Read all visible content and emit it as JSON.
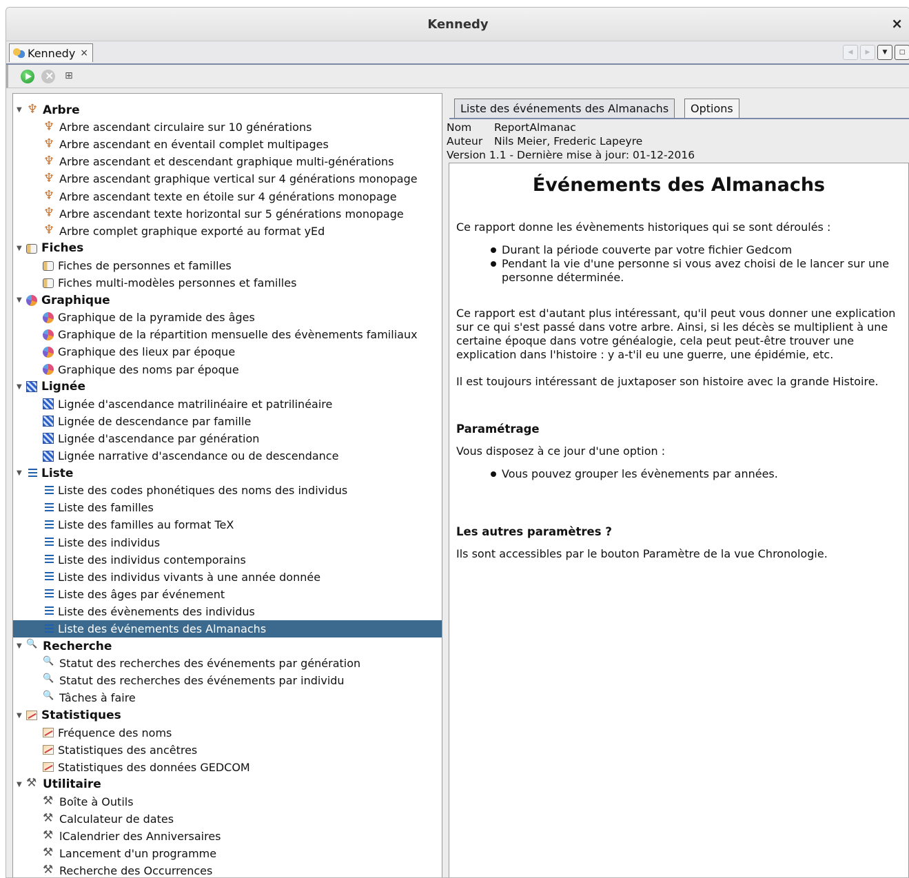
{
  "window": {
    "title": "Kennedy"
  },
  "doc_tab": {
    "label": "Kennedy"
  },
  "tree": [
    {
      "label": "Arbre",
      "icon": "arbre",
      "items": [
        "Arbre ascendant circulaire sur 10 générations",
        "Arbre ascendant en éventail complet multipages",
        "Arbre ascendant et descendant graphique multi-générations",
        "Arbre ascendant graphique vertical sur 4 générations monopage",
        "Arbre ascendant texte en étoile sur 4 générations monopage",
        "Arbre ascendant texte horizontal sur 5 générations monopage",
        "Arbre complet graphique exporté au format yEd"
      ]
    },
    {
      "label": "Fiches",
      "icon": "fiches",
      "items": [
        "Fiches de personnes et familles",
        "Fiches multi-modèles personnes et familles"
      ]
    },
    {
      "label": "Graphique",
      "icon": "graph",
      "items": [
        "Graphique de la pyramide des âges",
        "Graphique de la répartition mensuelle des évènements familiaux",
        "Graphique des lieux par époque",
        "Graphique des noms par époque"
      ]
    },
    {
      "label": "Lignée",
      "icon": "lignee",
      "items": [
        "Lignée d'ascendance matrilinéaire et patrilinéaire",
        "Lignée de descendance par famille",
        "Lignée d'ascendance par génération",
        "Lignée narrative d'ascendance ou de descendance"
      ]
    },
    {
      "label": "Liste",
      "icon": "liste",
      "items": [
        "Liste des codes phonétiques des noms des individus",
        "Liste des familles",
        "Liste des familles au format TeX",
        "Liste des individus",
        "Liste des individus contemporains",
        "Liste des individus vivants à une année donnée",
        "Liste des âges par événement",
        "Liste des évènements des individus",
        "Liste des événements des Almanachs"
      ]
    },
    {
      "label": "Recherche",
      "icon": "rech",
      "items": [
        "Statut des recherches des événements par génération",
        "Statut des recherches des événements par individu",
        "Tâches à faire"
      ]
    },
    {
      "label": "Statistiques",
      "icon": "stat",
      "items": [
        "Fréquence des noms",
        "Statistiques des ancêtres",
        "Statistiques des données GEDCOM"
      ]
    },
    {
      "label": "Utilitaire",
      "icon": "util",
      "items": [
        "Boîte à Outils",
        "Calculateur de dates",
        "lCalendrier des Anniversaires",
        "Lancement d'un programme",
        "Recherche des Occurrences"
      ]
    }
  ],
  "selected_item": "Liste des événements des Almanachs",
  "right_tabs": [
    "Liste des événements des Almanachs",
    "Options"
  ],
  "meta": {
    "nom_label": "Nom",
    "nom_value": "ReportAlmanac",
    "auteur_label": "Auteur",
    "auteur_value": "Nils Meier, Frederic Lapeyre",
    "version_line": "Version 1.1 - Dernière mise à jour: 01-12-2016"
  },
  "doc": {
    "title": "Événements des Almanachs",
    "intro": "Ce rapport donne les évènements historiques qui se sont déroulés :",
    "bullets1": [
      "Durant la période couverte par votre fichier Gedcom",
      "Pendant la vie d'une personne si vous avez choisi de le lancer sur une personne déterminée."
    ],
    "para2": "Ce rapport est d'autant plus intéressant, qu'il peut vous donner une explication sur ce qui s'est passé dans votre arbre. Ainsi, si les décès se multiplient à une certaine époque dans votre généalogie, cela peut peut-être trouver une explication dans l'histoire : y a-t'il eu une guerre, une épidémie, etc.",
    "para3": "Il est toujours intéressant de juxtaposer son histoire avec la grande Histoire.",
    "h_param": "Paramétrage",
    "param_intro": "Vous disposez à ce jour d'une option :",
    "bullets2": [
      "Vous pouvez grouper les évènements par années."
    ],
    "h_autres": "Les autres paramètres ?",
    "autres_text": "Ils sont accessibles par le bouton Paramètre de la vue Chronologie."
  }
}
